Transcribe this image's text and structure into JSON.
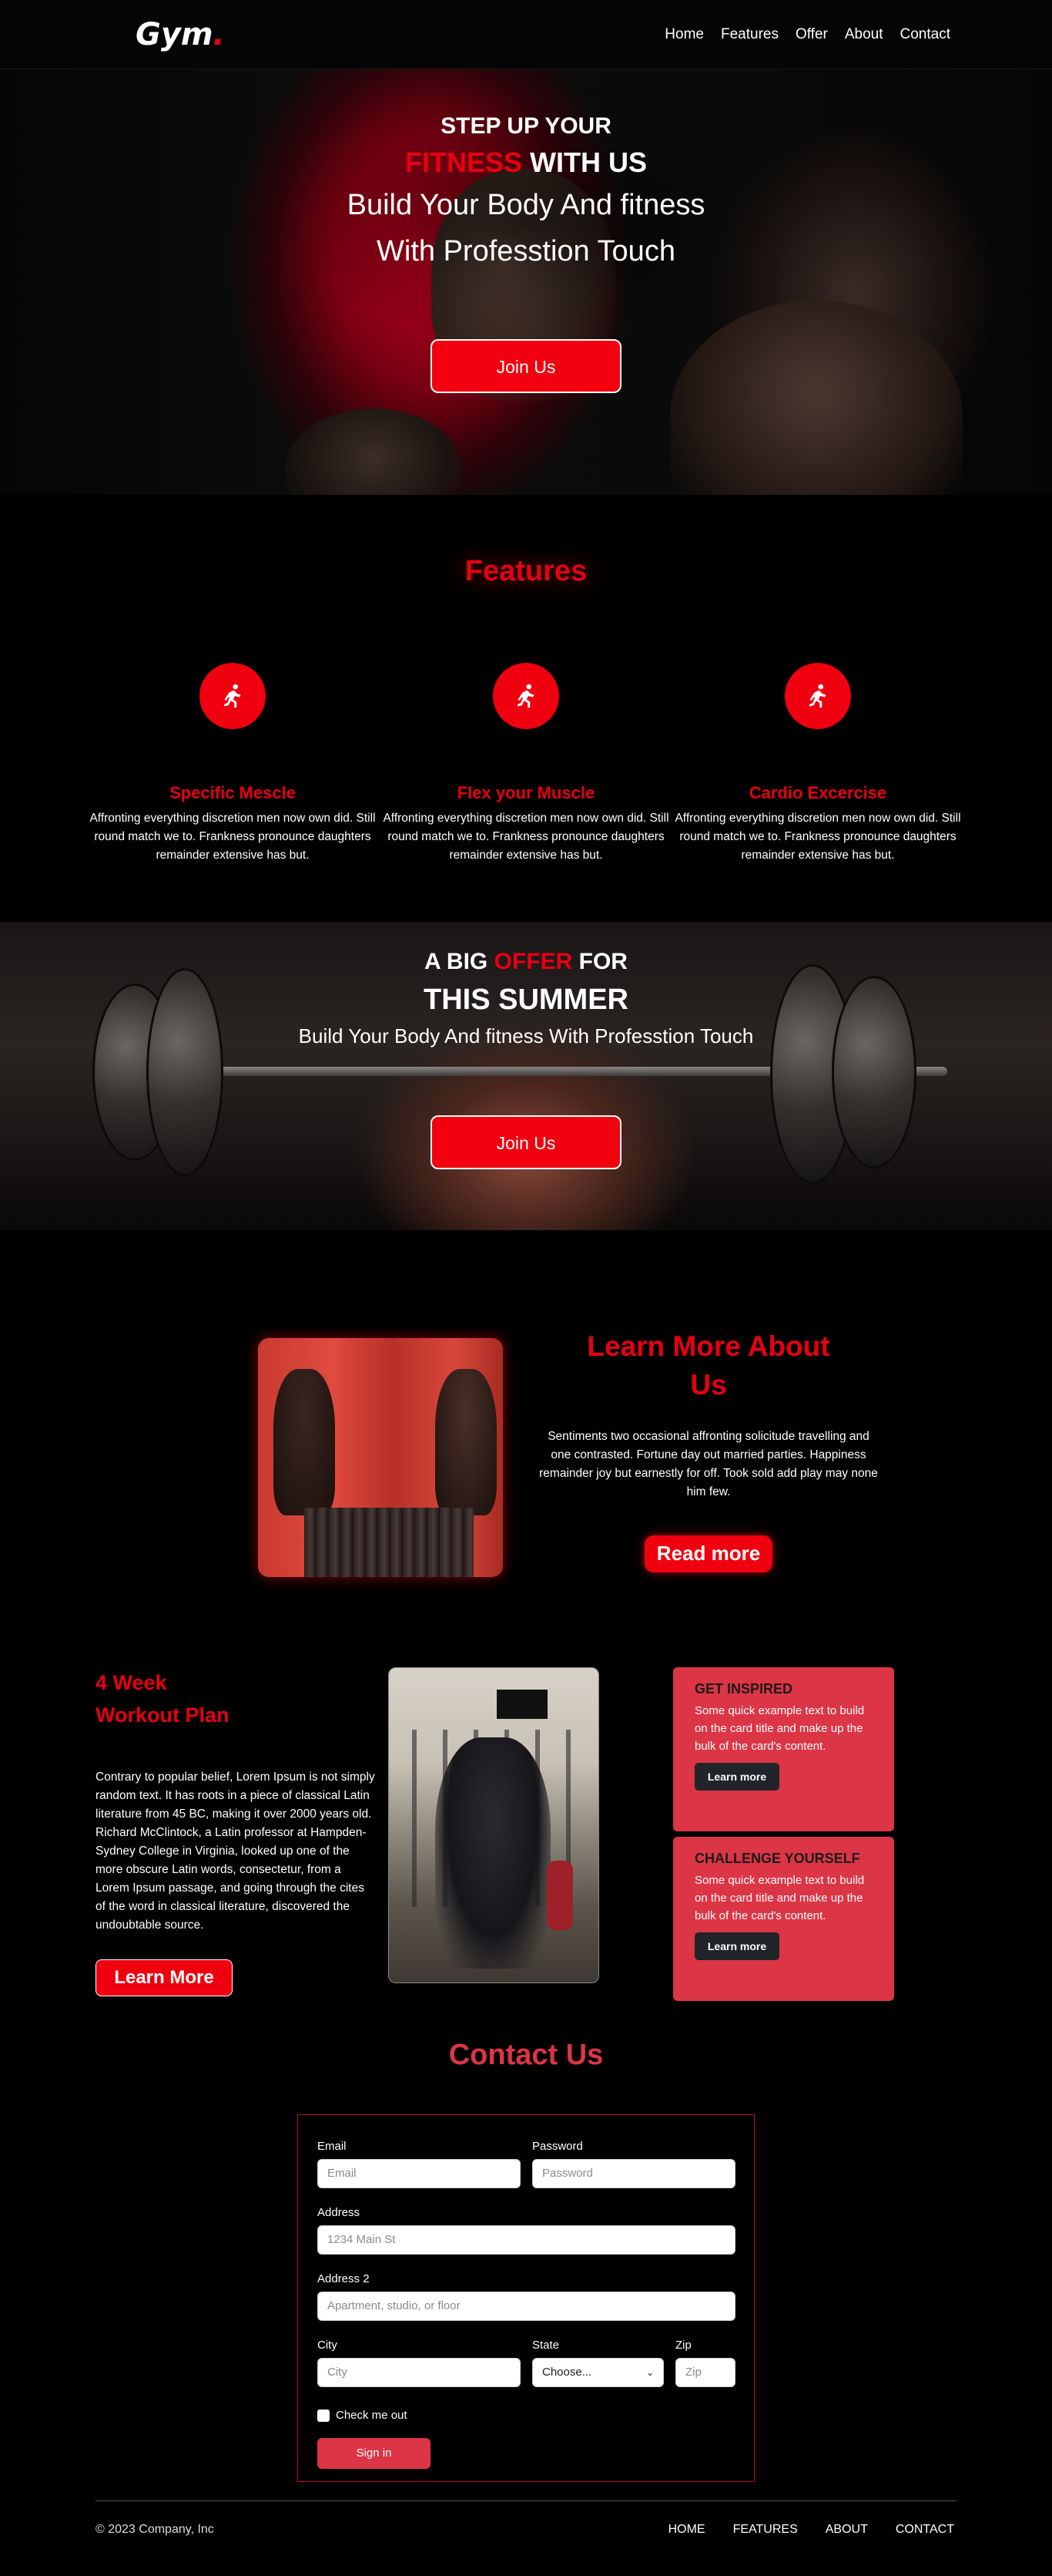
{
  "nav": {
    "logo": "Gym",
    "logo_dot": ".",
    "links": [
      "Home",
      "Features",
      "Offer",
      "About",
      "Contact"
    ]
  },
  "hero": {
    "line1": "STEP UP YOUR",
    "line2_red": "FITNESS",
    "line2_rest": " WITH US",
    "line3": "Build Your Body And fitness",
    "line4": "With Professtion Touch",
    "button": "Join Us"
  },
  "features": {
    "title": "Features",
    "items": [
      {
        "icon": "runner-icon",
        "title": "Specific Mescle",
        "text": "Affronting everything discretion men now own did. Still round match we to. Frankness pronounce daughters remainder extensive has but."
      },
      {
        "icon": "runner-icon",
        "title": "Flex your Muscle",
        "text": "Affronting everything discretion men now own did. Still round match we to. Frankness pronounce daughters remainder extensive has but."
      },
      {
        "icon": "runner-icon",
        "title": "Cardio Excercise",
        "text": "Affronting everything discretion men now own did. Still round match we to. Frankness pronounce daughters remainder extensive has but."
      }
    ]
  },
  "offer": {
    "line1_pre": "A BIG ",
    "line1_red": "OFFER",
    "line1_post": " FOR",
    "line2": "THIS SUMMER",
    "line3": "Build Your Body And fitness With Professtion Touch",
    "button": "Join Us"
  },
  "about": {
    "title_line1": "Learn More About",
    "title_line2": "Us",
    "body": "Sentiments two occasional affronting solicitude travelling and one contrasted. Fortune day out married parties. Happiness remainder joy but earnestly for off. Took sold add play may none him few.",
    "button": "Read more"
  },
  "workout": {
    "title_line1": "4 Week",
    "title_line2": "Workout Plan",
    "body": "Contrary to popular belief, Lorem Ipsum is not simply random text. It has roots in a piece of classical Latin literature from 45 BC, making it over 2000 years old. Richard McClintock, a Latin professor at Hampden-Sydney College in Virginia, looked up one of the more obscure Latin words, consectetur, from a Lorem Ipsum passage, and going through the cites of the word in classical literature, discovered the undoubtable source.",
    "button": "Learn More"
  },
  "cards": [
    {
      "title": "GET INSPIRED",
      "text": "Some quick example text to build on the card title and make up the bulk of the card's content.",
      "button": "Learn more"
    },
    {
      "title": "CHALLENGE YOURSELF",
      "text": "Some quick example text to build on the card title and make up the bulk of the card's content.",
      "button": "Learn more"
    }
  ],
  "contact": {
    "title": "Contact Us",
    "email_label": "Email",
    "email_placeholder": "Email",
    "password_label": "Password",
    "password_placeholder": "Password",
    "address_label": "Address",
    "address_placeholder": "1234 Main St",
    "address2_label": "Address 2",
    "address2_placeholder": "Apartment, studio, or floor",
    "city_label": "City",
    "city_placeholder": "City",
    "state_label": "State",
    "state_value": "Choose...",
    "zip_label": "Zip",
    "zip_placeholder": "Zip",
    "check_label": "Check me out",
    "submit": "Sign in"
  },
  "footer": {
    "copyright": "© 2023 Company, Inc",
    "links": [
      "HOME",
      "FEATURES",
      "ABOUT",
      "CONTACT"
    ]
  },
  "colors": {
    "accent": "#e60012",
    "card": "#dc3545",
    "background": "#000000"
  }
}
